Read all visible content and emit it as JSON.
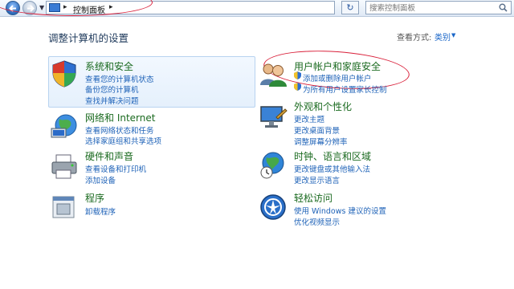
{
  "toolbar": {
    "breadcrumb": "控制面板",
    "search_placeholder": "搜索控制面板"
  },
  "main": {
    "title": "调整计算机的设置",
    "view_by_label": "查看方式:",
    "view_by_value": "类别"
  },
  "categories": [
    {
      "title": "系统和安全",
      "links": [
        "查看您的计算机状态",
        "备份您的计算机",
        "查找并解决问题"
      ]
    },
    {
      "title": "网络和 Internet",
      "links": [
        "查看网络状态和任务",
        "选择家庭组和共享选项"
      ]
    },
    {
      "title": "硬件和声音",
      "links": [
        "查看设备和打印机",
        "添加设备"
      ]
    },
    {
      "title": "程序",
      "links": [
        "卸载程序"
      ]
    },
    {
      "title": "用户帐户和家庭安全",
      "links": [
        "添加或删除用户帐户",
        "为所有用户设置家长控制"
      ]
    },
    {
      "title": "外观和个性化",
      "links": [
        "更改主题",
        "更改桌面背景",
        "调整屏幕分辨率"
      ]
    },
    {
      "title": "时钟、语言和区域",
      "links": [
        "更改键盘或其他输入法",
        "更改显示语言"
      ]
    },
    {
      "title": "轻松访问",
      "links": [
        "使用 Windows 建议的设置",
        "优化视频显示"
      ]
    }
  ],
  "colors": {
    "link": "#1f63b8",
    "category_title": "#1a6a1f",
    "annotation": "#d9203a"
  }
}
